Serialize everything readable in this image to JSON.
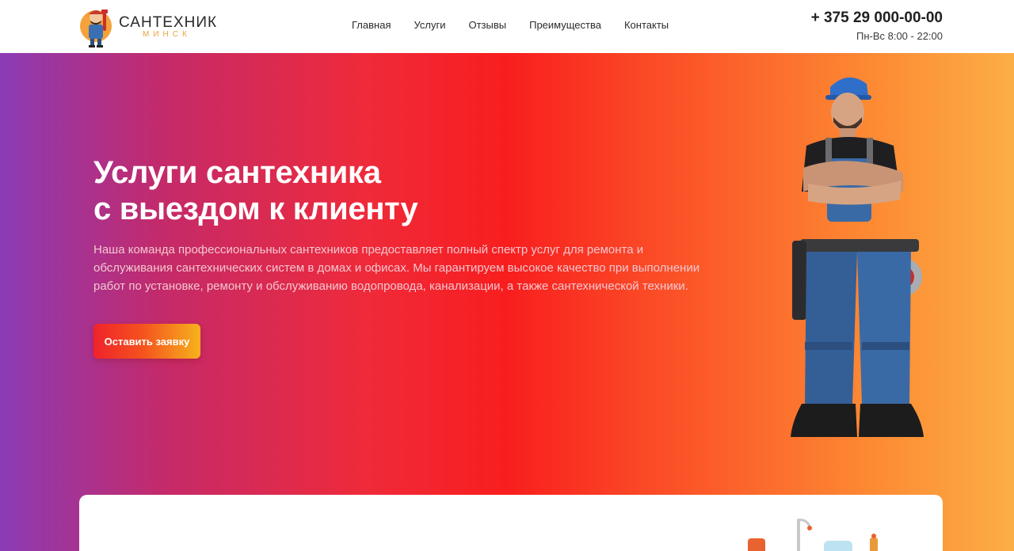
{
  "header": {
    "logo": {
      "title": "САНТЕХНИК",
      "subtitle": "МИНСК"
    },
    "nav": [
      {
        "label": "Главная"
      },
      {
        "label": "Услуги"
      },
      {
        "label": "Отзывы"
      },
      {
        "label": "Преимущества"
      },
      {
        "label": "Контакты"
      }
    ],
    "phone": "+ 375 29 000-00-00",
    "hours": "Пн-Вс 8:00 - 22:00"
  },
  "hero": {
    "title_line1": "Услуги сантехника",
    "title_line2": "с выездом к клиенту",
    "description": "Наша команда профессиональных сантехников предоставляет полный спектр услуг для ремонта и обслуживания сантехнических систем в домах и офисах. Мы гарантируем высокое качество при выполнении работ по установке, ремонту и обслуживанию водопровода, канализации, а также сантехнической техники.",
    "cta_label": "Оставить заявку"
  },
  "colors": {
    "gradient_start": "#8b3bb6",
    "gradient_mid": "#f81e1e",
    "gradient_end": "#fcae46",
    "logo_accent": "#e8a33a",
    "cta_start": "#f0232b",
    "cta_end": "#f7b21d"
  },
  "icons": {
    "logo": "plumber-mascot-icon",
    "hero_image": "plumber-photo",
    "card_image": "plumbing-fixtures-illustration"
  }
}
